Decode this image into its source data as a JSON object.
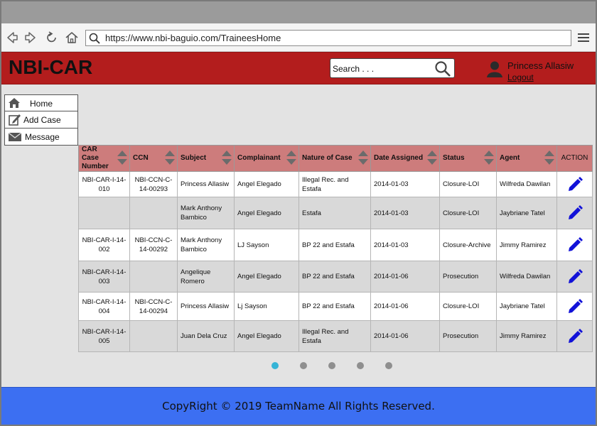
{
  "browser": {
    "url": "https://www.nbi-baguio.com/TraineesHome"
  },
  "header": {
    "brand": "NBI-CAR",
    "search_placeholder": "Search . . .",
    "user_name": "Princess Allasiw",
    "logout_label": "Logout",
    "brand_color": "#b31d1d"
  },
  "sidebar": {
    "items": [
      {
        "label": "Home",
        "icon": "home-icon"
      },
      {
        "label": "Add Case",
        "icon": "edit-note-icon"
      },
      {
        "label": "Message",
        "icon": "envelope-icon"
      }
    ]
  },
  "table": {
    "columns": [
      "CAR Case Number",
      "CCN",
      "Subject",
      "Complainant",
      "Nature of Case",
      "Date Assigned",
      "Status",
      "Agent",
      "ACTION"
    ],
    "rows": [
      [
        "NBI-CAR-I-14-010",
        "NBI-CCN-C-14-00293",
        "Princess Allasiw",
        "Angel Elegado",
        "Illegal Rec. and Estafa",
        "2014-01-03",
        "Closure-LOI",
        "Wilfreda Dawilan"
      ],
      [
        "",
        "",
        "Mark Anthony Bambico",
        "Angel Elegado",
        "Estafa",
        "2014-01-03",
        "Closure-LOI",
        "Jaybriane Tatel"
      ],
      [
        "NBI-CAR-I-14-002",
        "NBI-CCN-C-14-00292",
        "Mark Anthony Bambico",
        "LJ Sayson",
        "BP 22 and Estafa",
        "2014-01-03",
        "Closure-Archive",
        "Jimmy Ramirez"
      ],
      [
        "NBI-CAR-I-14-003",
        "",
        "Angelique Romero",
        "Angel Elegado",
        "BP 22 and Estafa",
        "2014-01-06",
        "Prosecution",
        "Wilfreda Dawilan"
      ],
      [
        "NBI-CAR-I-14-004",
        "NBI-CCN-C-14-00294",
        "Princess Allasiw",
        "Lj Sayson",
        "BP 22 and Estafa",
        "2014-01-06",
        "Closure-LOI",
        "Jaybriane Tatel"
      ],
      [
        "NBI-CAR-I-14-005",
        "",
        "Juan Dela Cruz",
        "Angel Elegado",
        "Illegal Rec. and Estafa",
        "2014-01-06",
        "Prosecution",
        "Jimmy Ramirez"
      ]
    ]
  },
  "pagination": {
    "pages": 5,
    "active": 1
  },
  "footer": {
    "text": "CopyRight © 2019 TeamName All Rights Reserved."
  }
}
